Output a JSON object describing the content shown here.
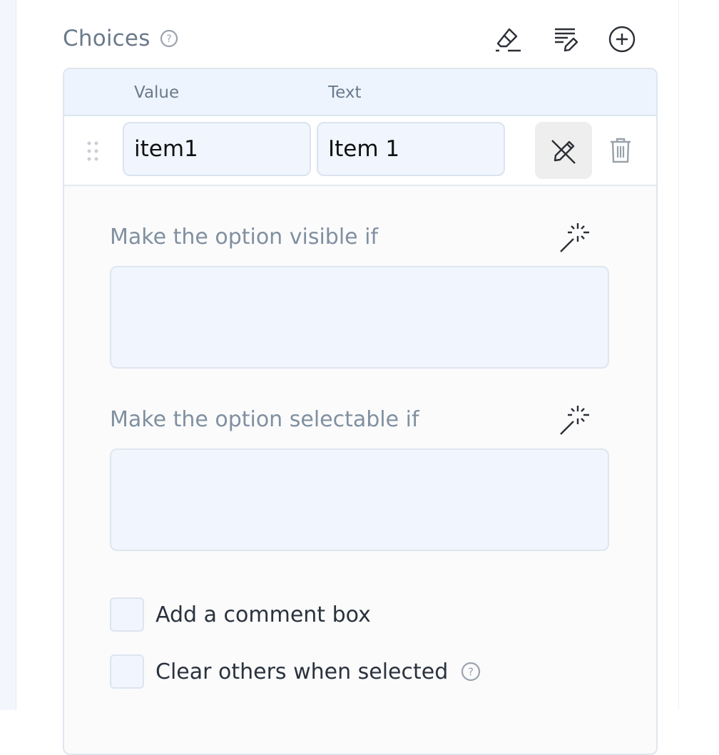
{
  "section": {
    "title": "Choices"
  },
  "toolbar": {
    "clear_icon": "eraser-icon",
    "edit_all_icon": "list-edit-icon",
    "add_icon": "plus-circle-icon"
  },
  "table": {
    "columns": [
      "Value",
      "Text"
    ],
    "rows": [
      {
        "value": "item1",
        "text": "Item 1"
      }
    ]
  },
  "detail": {
    "visible_if_label": "Make the option visible if",
    "enable_if_label": "Make the option selectable if",
    "comment_label": "Add a comment box",
    "clear_others_label": "Clear others when selected"
  },
  "colors": {
    "accent_bg": "#f0f5fe",
    "header_bg": "#edf4fe",
    "label_gray": "#8090a0",
    "icon_dark": "#2b2f36"
  }
}
